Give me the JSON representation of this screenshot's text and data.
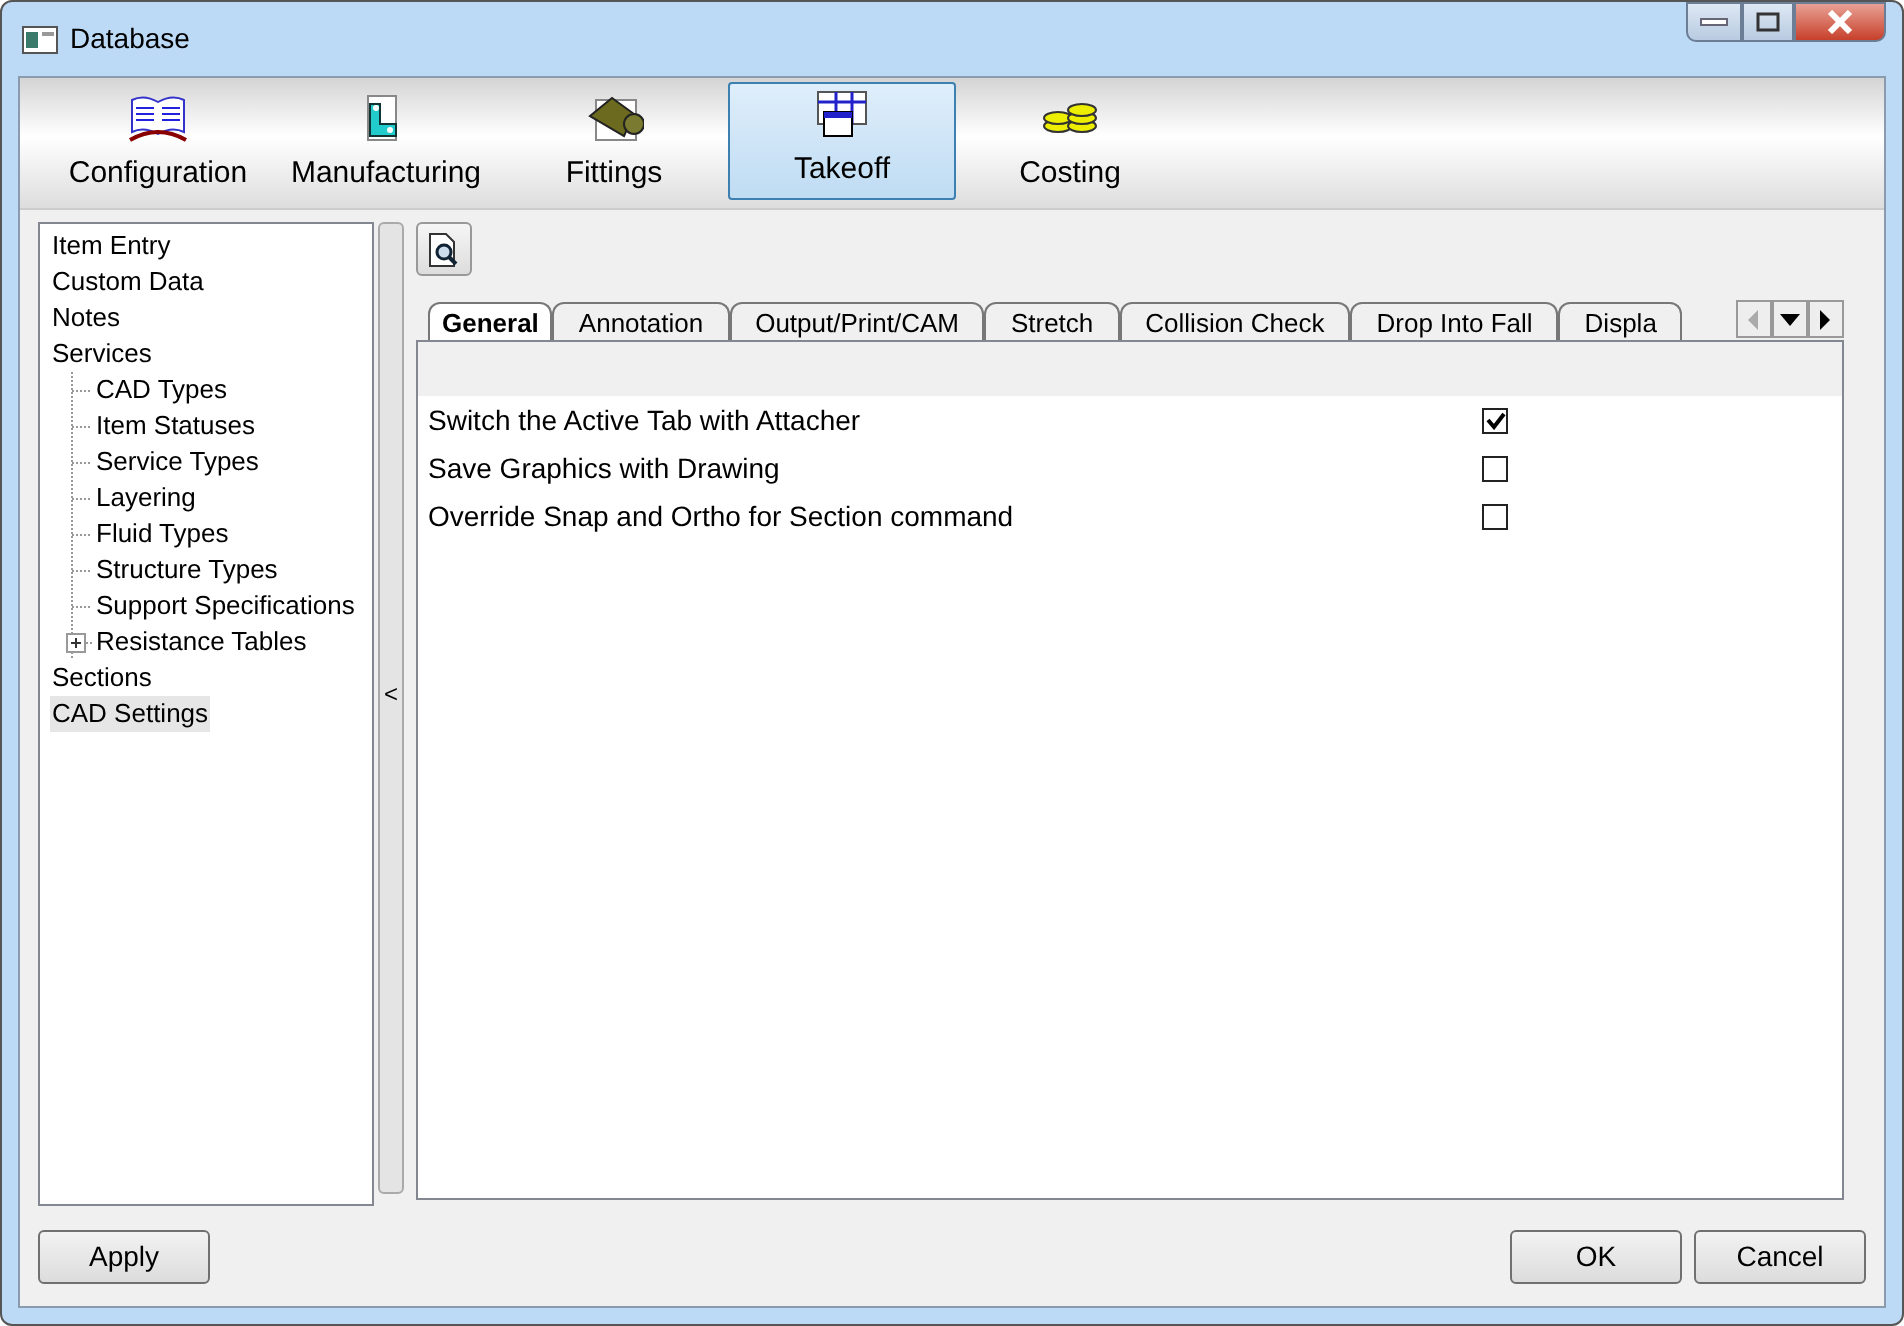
{
  "window": {
    "title": "Database"
  },
  "toolbar": [
    {
      "label": "Configuration",
      "selected": false
    },
    {
      "label": "Manufacturing",
      "selected": false
    },
    {
      "label": "Fittings",
      "selected": false
    },
    {
      "label": "Takeoff",
      "selected": true
    },
    {
      "label": "Costing",
      "selected": false
    }
  ],
  "tree": [
    {
      "label": "Item Entry",
      "selected": false
    },
    {
      "label": "Custom Data",
      "selected": false
    },
    {
      "label": "Notes",
      "selected": false
    },
    {
      "label": "Services",
      "selected": false,
      "children": [
        {
          "label": "CAD Types",
          "selected": false
        },
        {
          "label": "Item Statuses",
          "selected": false
        },
        {
          "label": "Service Types",
          "selected": false
        },
        {
          "label": "Layering",
          "selected": false
        },
        {
          "label": "Fluid Types",
          "selected": false
        },
        {
          "label": "Structure Types",
          "selected": false
        },
        {
          "label": "Support Specifications",
          "selected": false
        },
        {
          "label": "Resistance Tables",
          "selected": false,
          "expanded": false
        }
      ]
    },
    {
      "label": "Sections",
      "selected": false
    },
    {
      "label": "CAD Settings",
      "selected": true
    }
  ],
  "splitter": {
    "label": "<"
  },
  "tabs": [
    {
      "label": "General",
      "selected": true
    },
    {
      "label": "Annotation",
      "selected": false
    },
    {
      "label": "Output/Print/CAM",
      "selected": false
    },
    {
      "label": "Stretch",
      "selected": false
    },
    {
      "label": "Collision Check",
      "selected": false
    },
    {
      "label": "Drop Into Fall",
      "selected": false
    },
    {
      "label": "Displa",
      "selected": false
    }
  ],
  "settings": [
    {
      "label": "Switch the Active Tab with Attacher",
      "checked": true
    },
    {
      "label": "Save Graphics with Drawing",
      "checked": false
    },
    {
      "label": "Override Snap and Ortho for Section command",
      "checked": false
    }
  ],
  "buttons": {
    "left": [
      "Apply"
    ],
    "right": [
      "OK",
      "Cancel"
    ]
  }
}
